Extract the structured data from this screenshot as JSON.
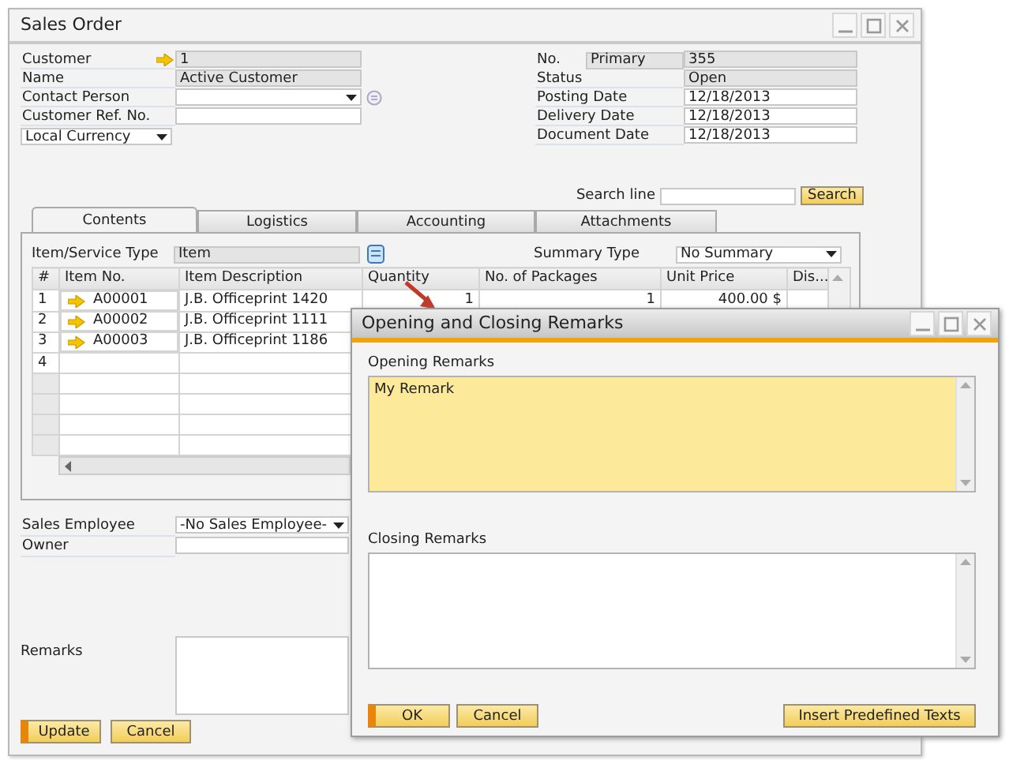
{
  "window": {
    "title": "Sales Order"
  },
  "header_left": [
    {
      "label": "Customer",
      "kind": "link",
      "value": "1",
      "editable": false
    },
    {
      "label": "Name",
      "kind": "text",
      "value": "Active Customer",
      "editable": false
    },
    {
      "label": "Contact Person",
      "kind": "dropdown",
      "editable": true
    },
    {
      "label": "Customer Ref. No.",
      "kind": "text",
      "editable": true
    }
  ],
  "currency": {
    "value": "Local Currency"
  },
  "header_right": [
    {
      "label": "No.",
      "series": "Primary",
      "value": "355",
      "editable": false
    },
    {
      "label": "Status",
      "value": "Open",
      "editable": false
    },
    {
      "label": "Posting Date",
      "value": "12/18/2013",
      "editable": true
    },
    {
      "label": "Delivery Date",
      "value": "12/18/2013",
      "editable": true
    },
    {
      "label": "Document Date",
      "value": "12/18/2013",
      "editable": true
    }
  ],
  "search": {
    "label": "Search line",
    "button": "Search"
  },
  "tabs": [
    {
      "label": "Contents",
      "selected": true
    },
    {
      "label": "Logistics",
      "selected": false
    },
    {
      "label": "Accounting",
      "selected": false
    },
    {
      "label": "Attachments",
      "selected": false
    }
  ],
  "item_type": {
    "label": "Item/Service Type",
    "value": "Item"
  },
  "summary_type": {
    "label": "Summary Type",
    "value": "No Summary"
  },
  "table": {
    "columns": [
      "#",
      "Item No.",
      "Item Description",
      "Quantity",
      "No. of Packages",
      "Unit Price",
      "Dis..."
    ],
    "rows": [
      {
        "number": "1",
        "item_no": "A00001",
        "description": "J.B. Officeprint 1420",
        "quantity": "1",
        "packages": "1",
        "unit_price": "400.00 $"
      },
      {
        "number": "2",
        "item_no": "A00002",
        "description": "J.B. Officeprint 1111"
      },
      {
        "number": "3",
        "item_no": "A00003",
        "description": "J.B. Officeprint 1186"
      },
      {
        "number": "4"
      }
    ]
  },
  "footer_fields": [
    {
      "label": "Sales Employee",
      "kind": "dropdown",
      "value": "-No Sales Employee-"
    },
    {
      "label": "Owner",
      "kind": "text"
    }
  ],
  "remarks": {
    "label": "Remarks"
  },
  "buttons": [
    {
      "label": "Update",
      "default": true
    },
    {
      "label": "Cancel",
      "default": false
    }
  ],
  "dialog": {
    "title": "Opening and Closing Remarks",
    "opening_label": "Opening Remarks",
    "opening_text": "My Remark",
    "closing_label": "Closing Remarks",
    "buttons": [
      {
        "label": "OK",
        "default": true
      },
      {
        "label": "Cancel",
        "default": false
      }
    ],
    "insert_button": "Insert Predefined Texts"
  }
}
